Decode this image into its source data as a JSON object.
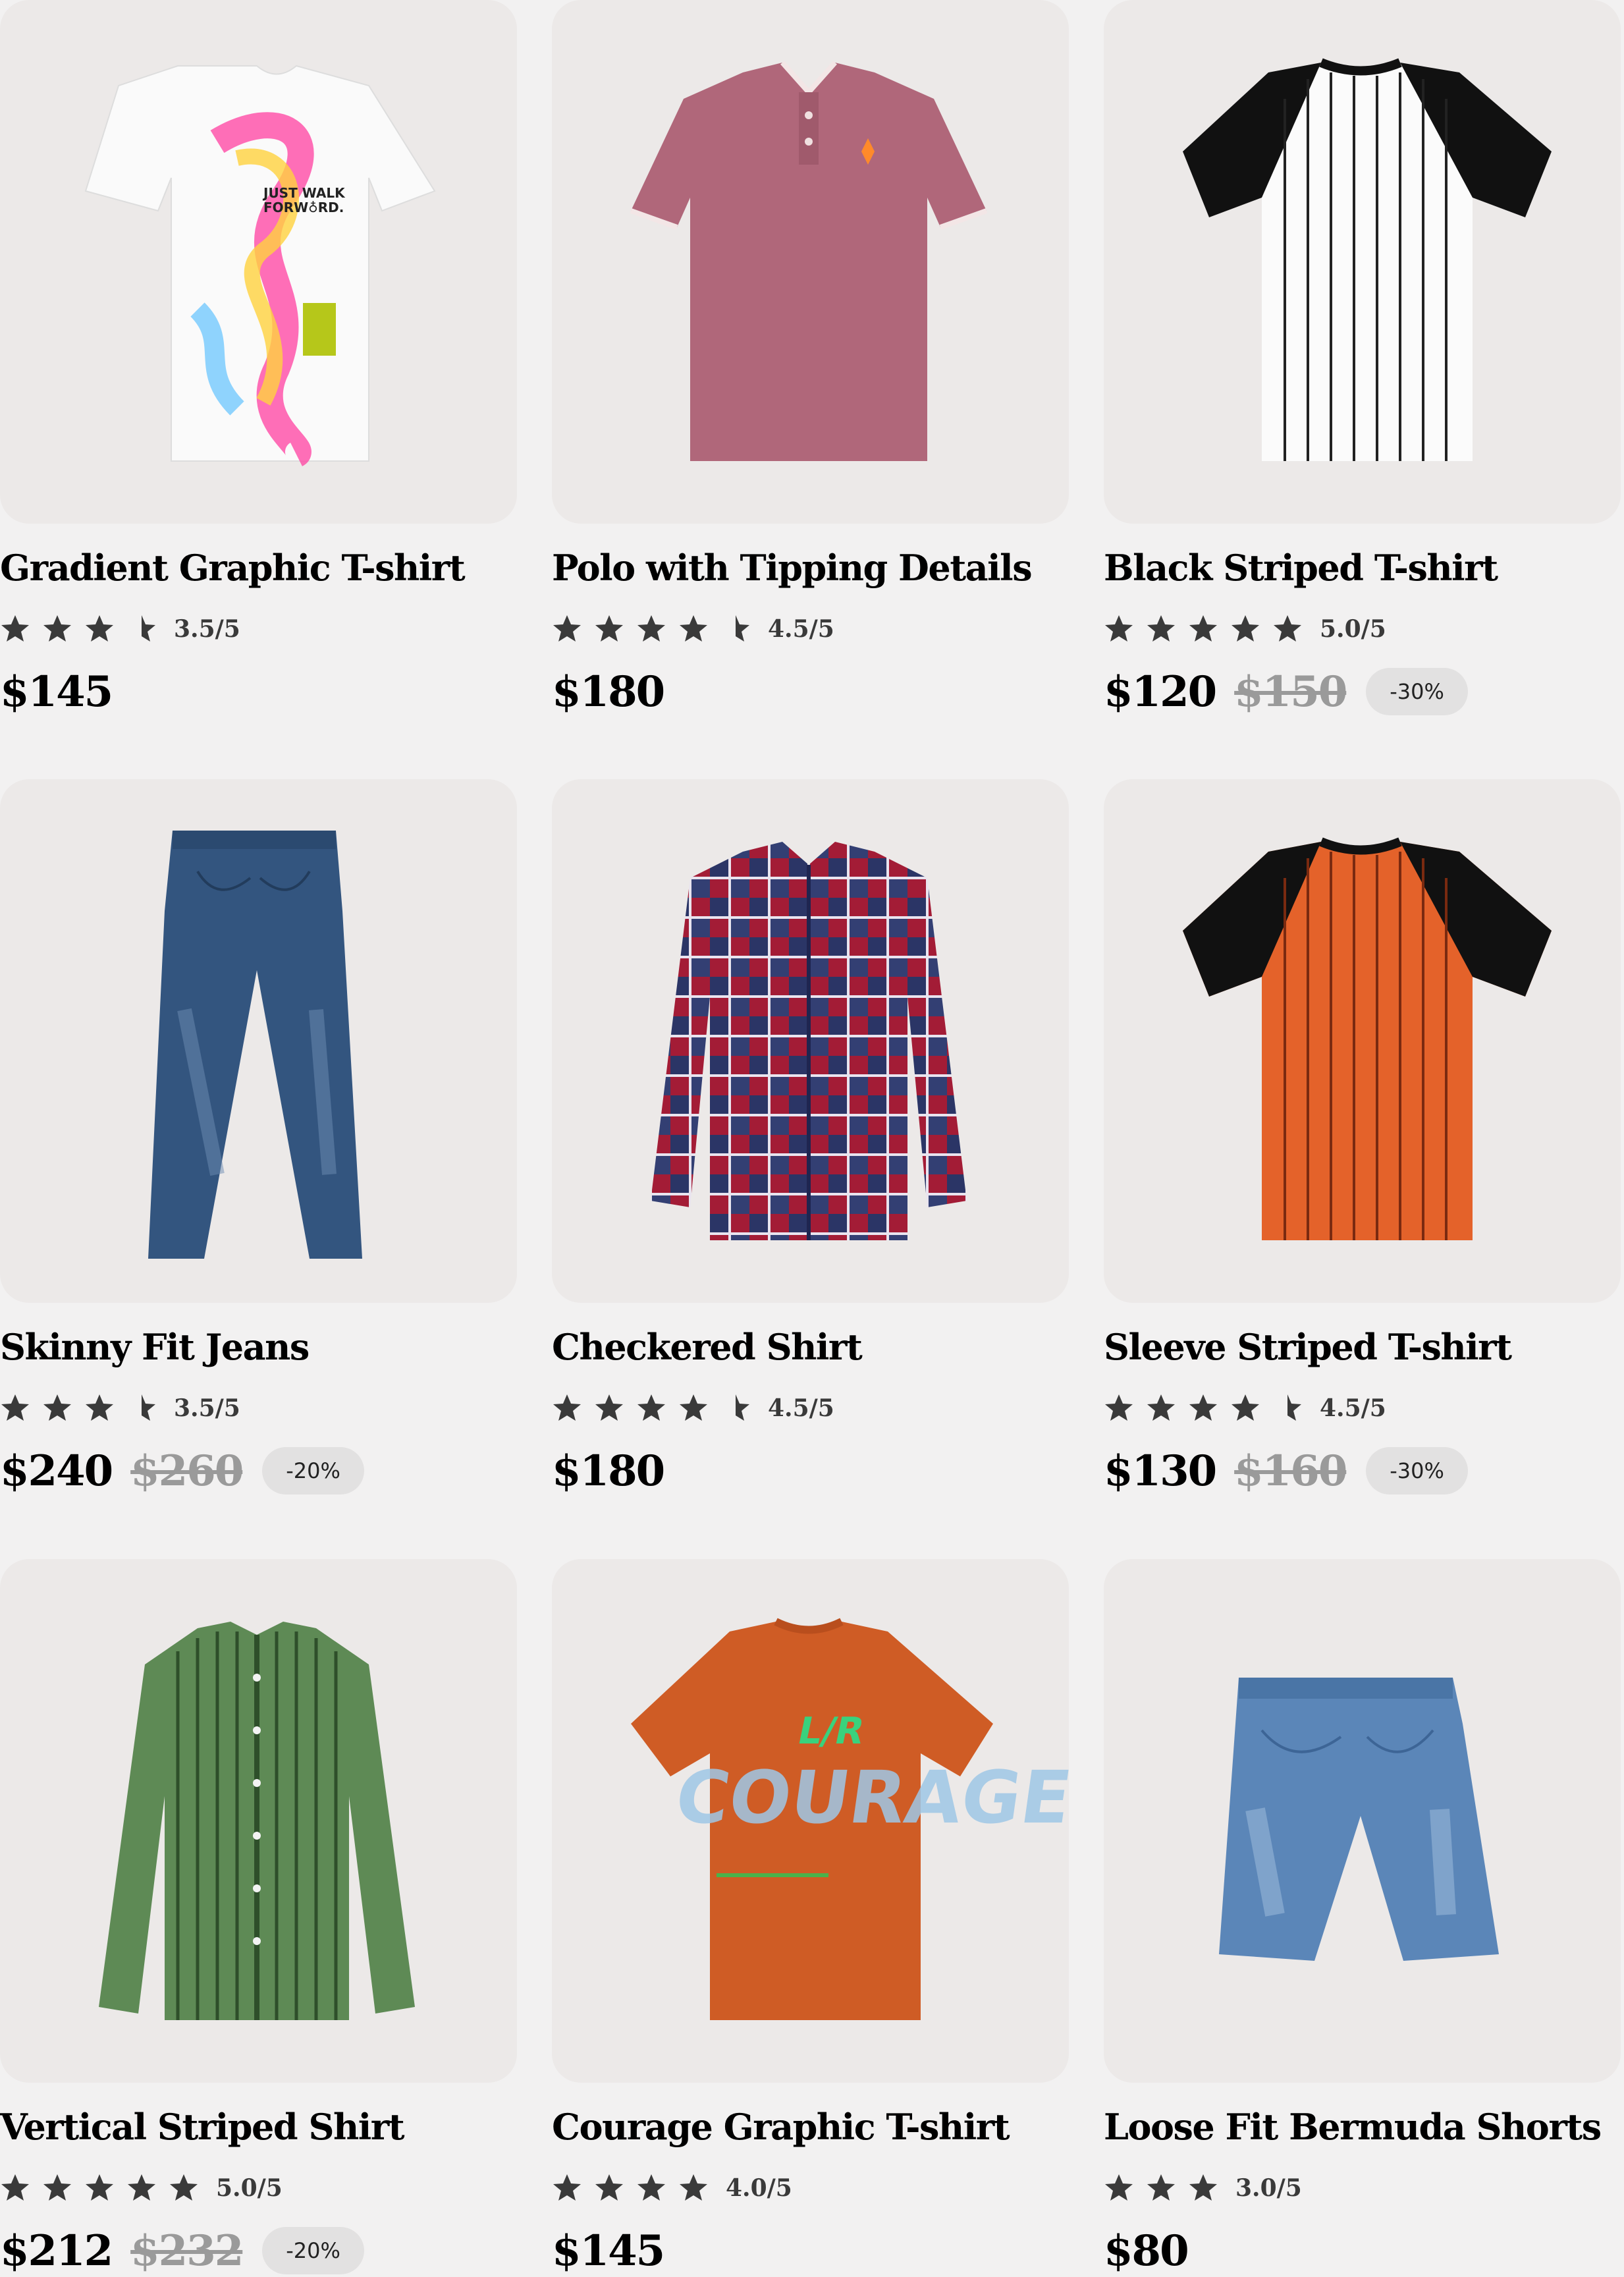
{
  "products": [
    {
      "name": "Gradient Graphic T-shirt",
      "rating_value": 3.5,
      "rating_text": "3.5/5",
      "price": "$145",
      "old_price": "",
      "discount": ""
    },
    {
      "name": "Polo with Tipping Details",
      "rating_value": 4.5,
      "rating_text": "4.5/5",
      "price": "$180",
      "old_price": "",
      "discount": ""
    },
    {
      "name": "Black Striped T-shirt",
      "rating_value": 5.0,
      "rating_text": "5.0/5",
      "price": "$120",
      "old_price": "$150",
      "discount": "-30%"
    },
    {
      "name": "Skinny Fit Jeans",
      "rating_value": 3.5,
      "rating_text": "3.5/5",
      "price": "$240",
      "old_price": "$260",
      "discount": "-20%"
    },
    {
      "name": "Checkered Shirt",
      "rating_value": 4.5,
      "rating_text": "4.5/5",
      "price": "$180",
      "old_price": "",
      "discount": ""
    },
    {
      "name": "Sleeve Striped T-shirt",
      "rating_value": 4.5,
      "rating_text": "4.5/5",
      "price": "$130",
      "old_price": "$160",
      "discount": "-30%"
    },
    {
      "name": "Vertical Striped Shirt",
      "rating_value": 5.0,
      "rating_text": "5.0/5",
      "price": "$212",
      "old_price": "$232",
      "discount": "-20%"
    },
    {
      "name": "Courage Graphic T-shirt",
      "rating_value": 4.0,
      "rating_text": "4.0/5",
      "price": "$145",
      "old_price": "",
      "discount": ""
    },
    {
      "name": "Loose Fit Bermuda Shorts",
      "rating_value": 3.0,
      "rating_text": "3.0/5",
      "price": "$80",
      "old_price": "",
      "discount": ""
    }
  ],
  "colors": {
    "page_background": "#f2f1f1",
    "card_background": "#ece9e8",
    "star": "#3a3a3a",
    "old_price": "#9a9a9a",
    "discount_badge": "#e2e1e1"
  }
}
